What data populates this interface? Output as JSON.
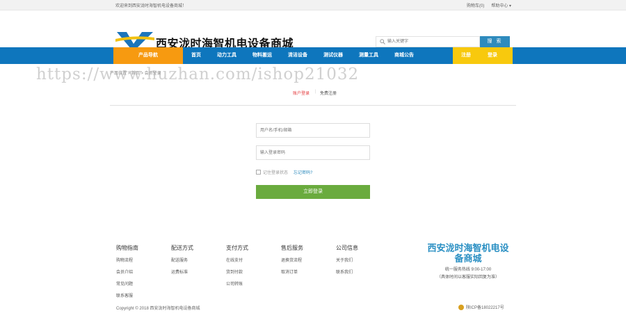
{
  "topbar": {
    "welcome": "欢迎来到西安泷时海智机电设备商城！",
    "cart": "购物车(0)",
    "help": "帮助中心"
  },
  "header": {
    "site_title": "西安泷时海智机电设备商城",
    "search_placeholder": "输入关键字",
    "search_button": "搜 索"
  },
  "nav": {
    "category_label": "产品导航",
    "items": [
      "首页",
      "动力工具",
      "物料搬运",
      "清洁设备",
      "测试仪器",
      "测量工具",
      "商城公告"
    ],
    "register": "注册",
    "login": "登录"
  },
  "breadcrumb": "产品位置 > 首页 > 会员登录",
  "watermark": "https://www.huzhan.com/ishop21032",
  "login": {
    "tab_account": "账户登录",
    "tab_register": "免费注册",
    "username_placeholder": "用户名/手机/邮箱",
    "password_placeholder": "输入登录密码",
    "remember": "记住登录状态",
    "forgot": "忘记密码?",
    "submit": "立即登录"
  },
  "footer": {
    "columns": [
      {
        "title": "购物指南",
        "links": [
          "购物流程",
          "会员介绍",
          "常见问题",
          "联系客服"
        ]
      },
      {
        "title": "配送方式",
        "links": [
          "配送服务",
          "运费标准"
        ]
      },
      {
        "title": "支付方式",
        "links": [
          "在线支付",
          "货到付款",
          "公司转账"
        ]
      },
      {
        "title": "售后服务",
        "links": [
          "退换货流程",
          "取消订单"
        ]
      },
      {
        "title": "公司信息",
        "links": [
          "关于我们",
          "联系我们"
        ]
      }
    ],
    "brand_name": "西安泷时海智机电设备商城",
    "hotline": "统一服务热线 9:00-17:00",
    "hotline_note": "（具体时间以客服实际回复为准）",
    "copyright": "Copyright © 2018 西安泷时海智机电设备商城",
    "icp": "陕ICP备18022217号"
  },
  "colors": {
    "nav_blue": "#0e76bd",
    "nav_orange": "#f79a10",
    "auth_yellow": "#f8c90d",
    "login_green": "#6aab3e",
    "brand_blue": "#2a8fc3"
  }
}
